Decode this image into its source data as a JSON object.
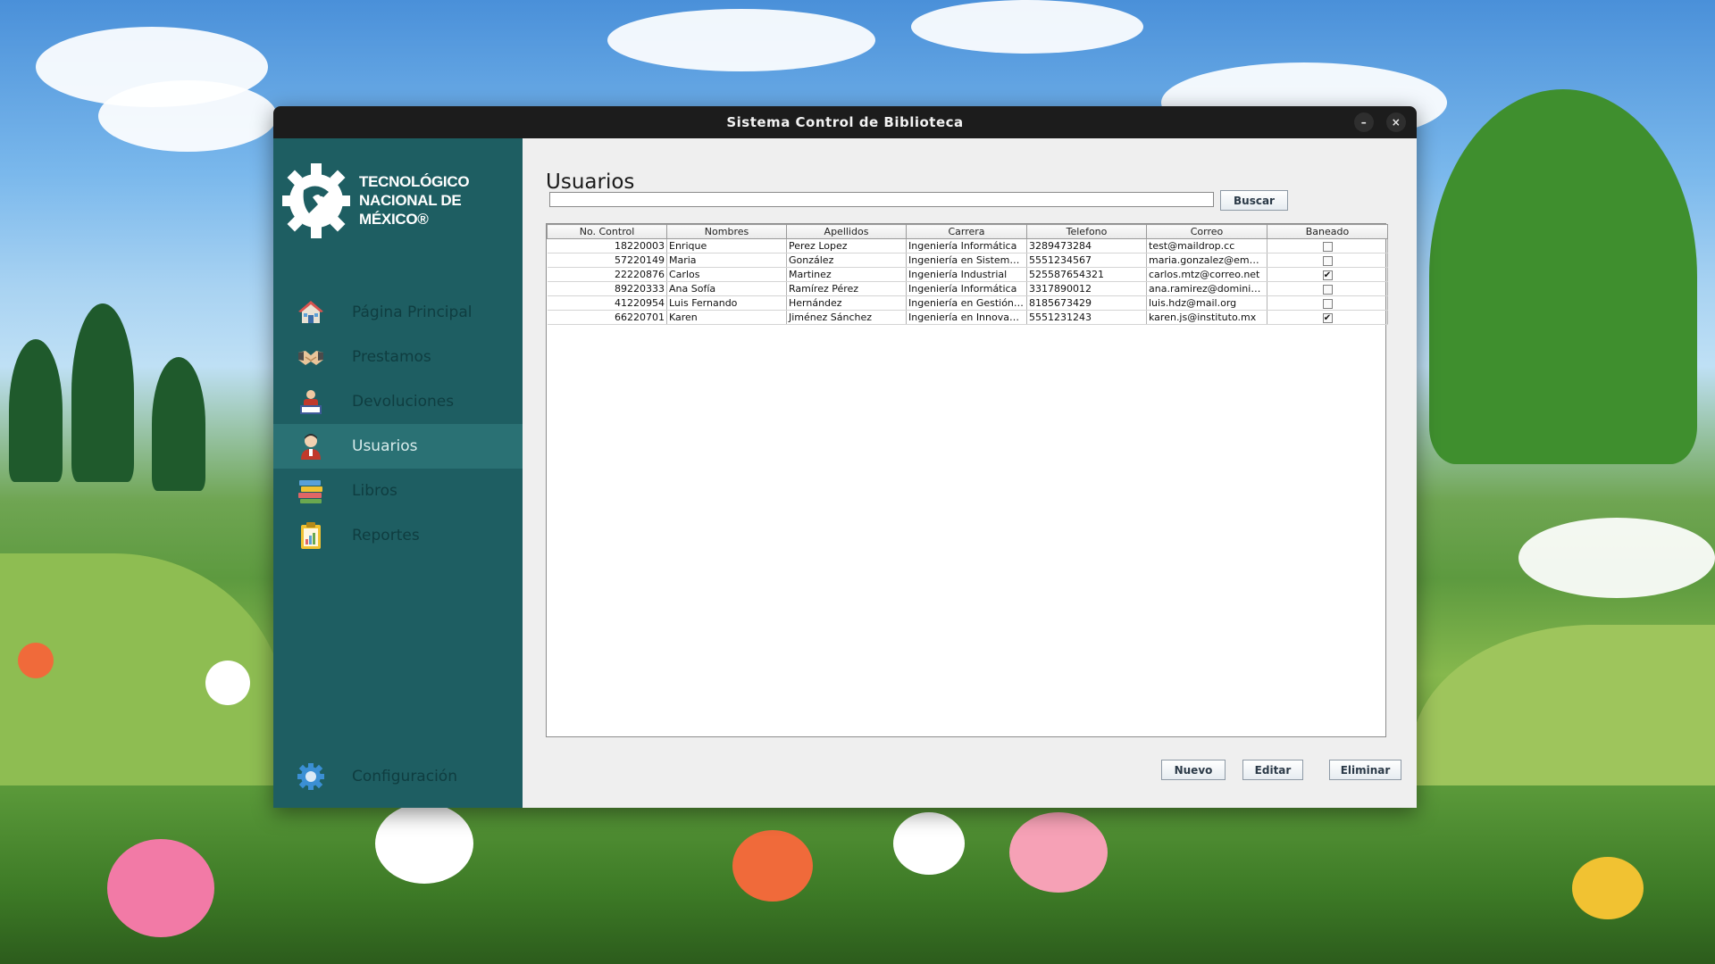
{
  "window": {
    "title": "Sistema Control de Biblioteca",
    "minimize_glyph": "–",
    "close_glyph": "×"
  },
  "logo": {
    "line1": "TECNOLÓGICO",
    "line2": "NACIONAL DE MÉXICO®",
    "icon": "tecnm-gear-logo"
  },
  "sidebar": {
    "items": [
      {
        "label": "Página Principal",
        "icon": "house-icon",
        "active": false
      },
      {
        "label": "Prestamos",
        "icon": "handshake-icon",
        "active": false
      },
      {
        "label": "Devoluciones",
        "icon": "return-icon",
        "active": false
      },
      {
        "label": "Usuarios",
        "icon": "user-icon",
        "active": true
      },
      {
        "label": "Libros",
        "icon": "books-icon",
        "active": false
      },
      {
        "label": "Reportes",
        "icon": "report-icon",
        "active": false
      }
    ],
    "config_label": "Configuración",
    "config_icon": "gear-icon"
  },
  "main": {
    "title": "Usuarios",
    "search_value": "",
    "search_button": "Buscar",
    "table": {
      "columns": [
        "No. Control",
        "Nombres",
        "Apellidos",
        "Carrera",
        "Telefono",
        "Correo",
        "Baneado"
      ],
      "rows": [
        [
          "18220003",
          "Enrique",
          "Perez Lopez",
          "Ingeniería Informática",
          "3289473284",
          "test@maildrop.cc",
          false
        ],
        [
          "57220149",
          "Maria",
          "González",
          "Ingeniería en Sistema...",
          "5551234567",
          "maria.gonzalez@emai...",
          false
        ],
        [
          "22220876",
          "Carlos",
          "Martinez",
          "Ingeniería Industrial",
          "525587654321",
          "carlos.mtz@correo.net",
          true
        ],
        [
          "89220333",
          "Ana Sofía",
          "Ramírez Pérez",
          "Ingeniería Informática",
          "3317890012",
          "ana.ramirez@dominio...",
          false
        ],
        [
          "41220954",
          "Luis Fernando",
          "Hernández",
          "Ingeniería en Gestión ...",
          "8185673429",
          "luis.hdz@mail.org",
          false
        ],
        [
          "66220701",
          "Karen",
          "Jiménez Sánchez",
          "Ingeniería en Innovaci...",
          "5551231243",
          "karen.js@instituto.mx",
          true
        ]
      ]
    },
    "buttons": {
      "new": "Nuevo",
      "edit": "Editar",
      "delete": "Eliminar"
    }
  },
  "colors": {
    "sidebar_bg": "#1e5e62",
    "sidebar_active": "#2a7174",
    "titlebar_bg": "#1c1c1c",
    "panel_bg": "#efefef"
  }
}
